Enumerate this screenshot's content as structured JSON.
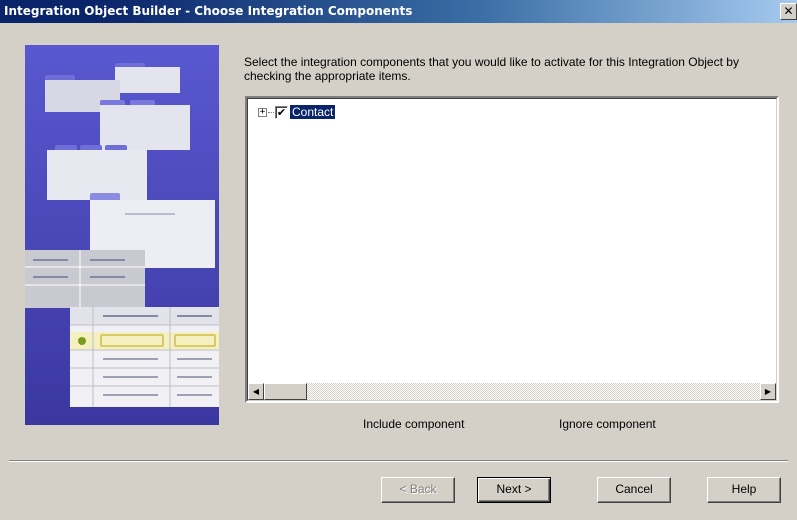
{
  "window": {
    "title": "Integration Object Builder - Choose Integration Components",
    "close_glyph": "✕"
  },
  "instructions": {
    "text": "Select the integration components that you would like to activate for this Integration Object by checking the appropriate items."
  },
  "tree": {
    "items": [
      {
        "label": "Contact",
        "checked": true,
        "expanded": false,
        "selected": true,
        "expander_glyph": "+",
        "check_glyph": "✔"
      }
    ]
  },
  "scrollbar": {
    "left_arrow": "◀",
    "right_arrow": "▶"
  },
  "legend": {
    "include": "Include component",
    "ignore": "Ignore component"
  },
  "buttons": {
    "back": "< Back",
    "next": "Next >",
    "cancel": "Cancel",
    "help": "Help"
  },
  "colors": {
    "title_bar": "#0a246a",
    "selection": "#0a246a",
    "wizard_bg": "#4a47b9",
    "dialog_bg": "#d4d0c8"
  },
  "icons": {
    "wizard_image": "folders-and-tables-illustration"
  }
}
